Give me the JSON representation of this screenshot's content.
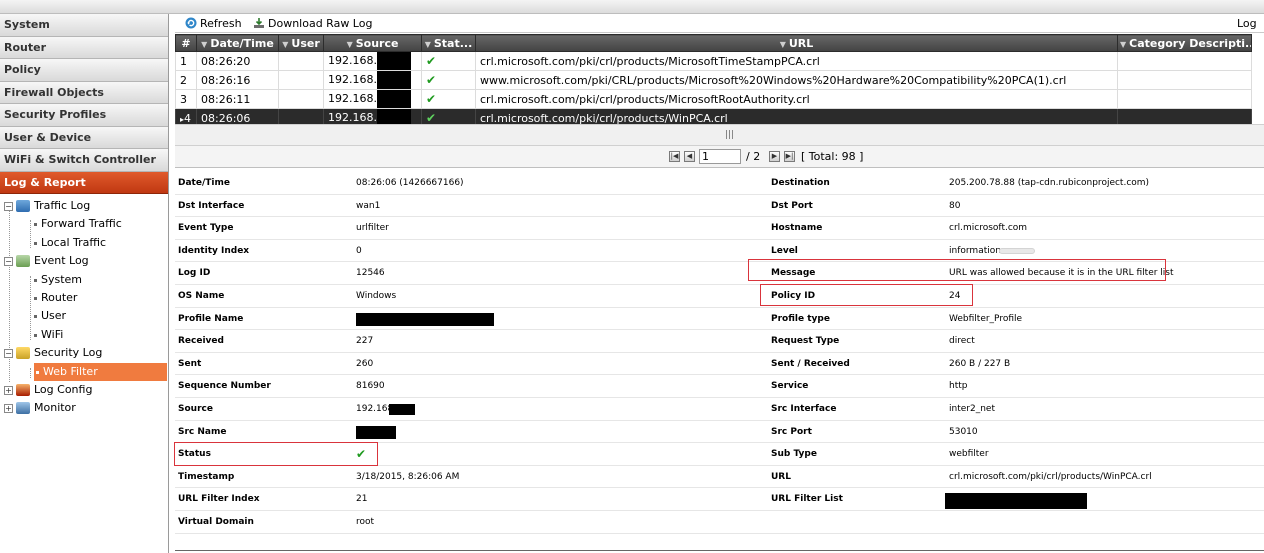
{
  "sidebar": {
    "nav": [
      "System",
      "Router",
      "Policy",
      "Firewall Objects",
      "Security Profiles",
      "User & Device",
      "WiFi & Switch Controller",
      "Log & Report"
    ],
    "tree": {
      "traffic_log": "Traffic Log",
      "forward_traffic": "Forward Traffic",
      "local_traffic": "Local Traffic",
      "event_log": "Event Log",
      "ev_system": "System",
      "ev_router": "Router",
      "ev_user": "User",
      "ev_wifi": "WiFi",
      "security_log": "Security Log",
      "web_filter": "Web Filter",
      "log_config": "Log Config",
      "monitor": "Monitor"
    }
  },
  "toolbar": {
    "refresh": "Refresh",
    "download": "Download Raw Log",
    "right_label": "Log"
  },
  "grid": {
    "columns": [
      "#",
      "Date/Time",
      "User",
      "Source",
      "Stat...",
      "URL",
      "Category Descripti..."
    ],
    "rows": [
      {
        "num": "1",
        "time": "08:26:20",
        "source": "192.168.",
        "url": "crl.microsoft.com/pki/crl/products/MicrosoftTimeStampPCA.crl"
      },
      {
        "num": "2",
        "time": "08:26:16",
        "source": "192.168.",
        "url": "www.microsoft.com/pki/CRL/products/Microsoft%20Windows%20Hardware%20Compatibility%20PCA(1).crl"
      },
      {
        "num": "3",
        "time": "08:26:11",
        "source": "192.168.",
        "url": "crl.microsoft.com/pki/crl/products/MicrosoftRootAuthority.crl"
      },
      {
        "num": "4",
        "time": "08:26:06",
        "source": "192.168.",
        "url": "crl.microsoft.com/pki/crl/products/WinPCA.crl"
      }
    ],
    "status_glyph": "✔"
  },
  "pager": {
    "page": "1",
    "of": "/ 2",
    "total": "[ Total: 98 ]"
  },
  "details": {
    "left": [
      {
        "label": "Date/Time",
        "value": "08:26:06 (1426667166)"
      },
      {
        "label": "Dst Interface",
        "value": "wan1"
      },
      {
        "label": "Event Type",
        "value": "urlfilter"
      },
      {
        "label": "Identity Index",
        "value": "0"
      },
      {
        "label": "Log ID",
        "value": "12546"
      },
      {
        "label": "OS Name",
        "value": "Windows"
      },
      {
        "label": "Profile Name",
        "value": ""
      },
      {
        "label": "Received",
        "value": "227"
      },
      {
        "label": "Sent",
        "value": "260"
      },
      {
        "label": "Sequence Number",
        "value": "81690"
      },
      {
        "label": "Source",
        "value": "192.168."
      },
      {
        "label": "Src Name",
        "value": ""
      },
      {
        "label": "Status",
        "value": "✔"
      },
      {
        "label": "Timestamp",
        "value": "3/18/2015, 8:26:06 AM"
      },
      {
        "label": "URL Filter Index",
        "value": "21"
      },
      {
        "label": "Virtual Domain",
        "value": "root"
      }
    ],
    "right": [
      {
        "label": "Destination",
        "value": "205.200.78.88 (tap-cdn.rubiconproject.com)"
      },
      {
        "label": "Dst Port",
        "value": "80"
      },
      {
        "label": "Hostname",
        "value": "crl.microsoft.com"
      },
      {
        "label": "Level",
        "value": "information"
      },
      {
        "label": "Message",
        "value": "URL was allowed because it is in the URL filter list"
      },
      {
        "label": "Policy ID",
        "value": "24"
      },
      {
        "label": "Profile type",
        "value": "Webfilter_Profile"
      },
      {
        "label": "Request Type",
        "value": "direct"
      },
      {
        "label": "Sent / Received",
        "value": "260 B / 227 B"
      },
      {
        "label": "Service",
        "value": "http"
      },
      {
        "label": "Src Interface",
        "value": "inter2_net"
      },
      {
        "label": "Src Port",
        "value": "53010"
      },
      {
        "label": "Sub Type",
        "value": "webfilter"
      },
      {
        "label": "URL",
        "value": "crl.microsoft.com/pki/crl/products/WinPCA.crl"
      },
      {
        "label": "URL Filter List",
        "value": ""
      }
    ]
  },
  "colors": {
    "accent": "#c9401a",
    "selected_tree": "#f07b3f",
    "header": "#4f4f4f",
    "highlight_box": "#d9343c",
    "check": "#1f9a1f"
  }
}
